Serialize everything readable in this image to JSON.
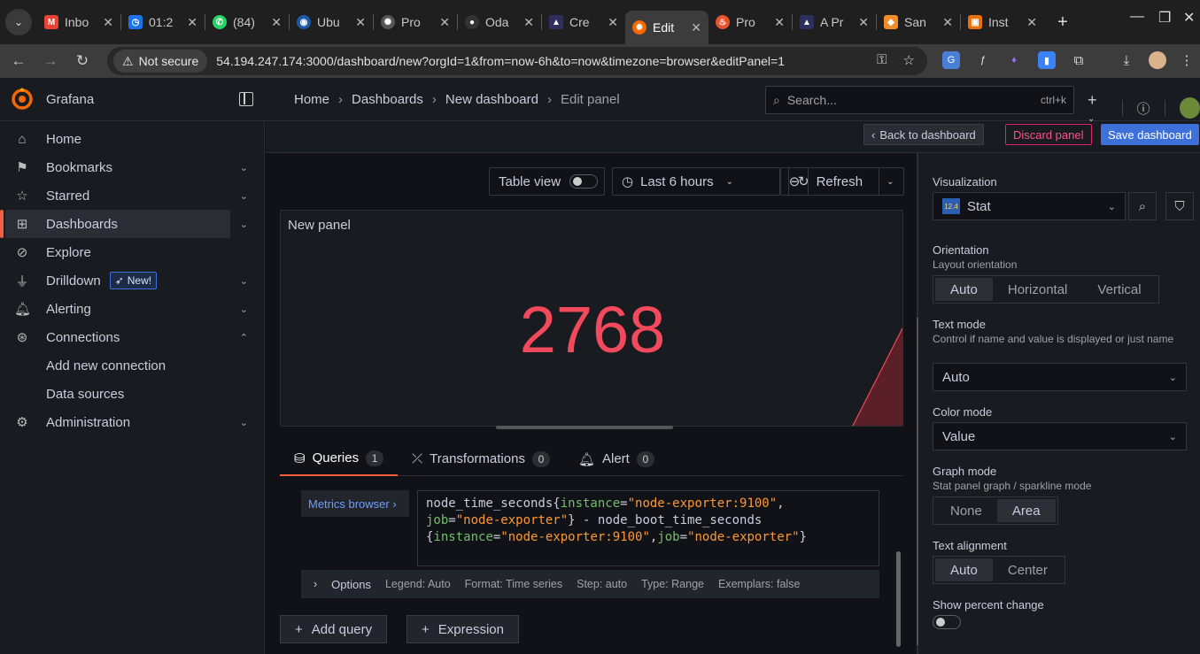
{
  "browser": {
    "tabs": [
      {
        "label": "Inbo",
        "icon": "gmail-icon",
        "color": "#ea4335"
      },
      {
        "label": "01:2",
        "icon": "clock-app-icon",
        "color": "#1a73e8"
      },
      {
        "label": "(84)",
        "icon": "whatsapp-icon",
        "color": "#25d366"
      },
      {
        "label": "Ubu",
        "icon": "ubuntu-icon",
        "color": "#1e5aa8"
      },
      {
        "label": "Pro",
        "icon": "chatgpt-icon",
        "color": "#444444"
      },
      {
        "label": "Oda",
        "icon": "github-icon",
        "color": "#333333"
      },
      {
        "label": "Cre",
        "icon": "atlassian-icon",
        "color": "#2f2f5f"
      },
      {
        "label": "Edit",
        "icon": "grafana-icon",
        "color": "#f46800"
      },
      {
        "label": "Pro",
        "icon": "prometheus-icon",
        "color": "#e6522c"
      },
      {
        "label": "A Pr",
        "icon": "atlassian-icon",
        "color": "#2f2f5f"
      },
      {
        "label": "San",
        "icon": "aws-icon",
        "color": "#f28c28"
      },
      {
        "label": "Inst",
        "icon": "instance-icon",
        "color": "#e8710a"
      }
    ],
    "active_tab": 7,
    "security_label": "Not secure",
    "url": "54.194.247.174:3000/dashboard/new?orgId=1&from=now-6h&to=now&timezone=browser&editPanel=1"
  },
  "grafana": {
    "brand": "Grafana",
    "breadcrumbs": [
      "Home",
      "Dashboards",
      "New dashboard",
      "Edit panel"
    ],
    "search_placeholder": "Search...",
    "search_shortcut": "ctrl+k",
    "add_label": "+"
  },
  "sidebar": {
    "items": [
      {
        "label": "Home",
        "icon": "home-icon"
      },
      {
        "label": "Bookmarks",
        "icon": "bookmark-icon"
      },
      {
        "label": "Starred",
        "icon": "star-icon"
      },
      {
        "label": "Dashboards",
        "icon": "dashboards-icon"
      },
      {
        "label": "Explore",
        "icon": "explore-icon"
      },
      {
        "label": "Drilldown",
        "icon": "drilldown-icon",
        "badge": "New!"
      },
      {
        "label": "Alerting",
        "icon": "bell-icon"
      },
      {
        "label": "Connections",
        "icon": "connections-icon"
      },
      {
        "label": "Add new connection"
      },
      {
        "label": "Data sources"
      },
      {
        "label": "Administration",
        "icon": "gear-icon"
      }
    ],
    "active": "Dashboards"
  },
  "toolbar": {
    "back_label": "Back to dashboard",
    "discard_label": "Discard panel",
    "save_label": "Save dashboard"
  },
  "panel_controls": {
    "table_view_label": "Table view",
    "time_range": "Last 6 hours",
    "refresh_label": "Refresh"
  },
  "panel": {
    "title": "New panel",
    "value": "2768",
    "value_color": "#f2495c"
  },
  "query_tabs": [
    {
      "label": "Queries",
      "count": "1"
    },
    {
      "label": "Transformations",
      "count": "0"
    },
    {
      "label": "Alert",
      "count": "0"
    }
  ],
  "query": {
    "metrics_browser_label": "Metrics browser ›",
    "line1_metric": "node_time_seconds{",
    "line1_k1": "instance",
    "line1_eq": "=",
    "line1_v1": "\"node-exporter:9100\"",
    "line1_end": ",",
    "line2_k": "job",
    "line2_eq": "=",
    "line2_v": "\"node-exporter\"",
    "line2_rest": "} - node_boot_time_seconds",
    "line3_open": "{",
    "line3_k1": "instance",
    "line3_eq1": "=",
    "line3_v1": "\"node-exporter:9100\"",
    "line3_comma": ",",
    "line3_k2": "job",
    "line3_eq2": "=",
    "line3_v2": "\"node-exporter\"",
    "line3_close": "}",
    "options_label": "Options",
    "options_summary": [
      "Legend: Auto",
      "Format: Time series",
      "Step: auto",
      "Type: Range",
      "Exemplars: false"
    ],
    "add_query_label": "Add query",
    "expression_label": "Expression"
  },
  "options_pane": {
    "visualization_label": "Visualization",
    "visualization_value": "Stat",
    "viz_icon_text": "12.4",
    "orientation_label": "Orientation",
    "orientation_desc": "Layout orientation",
    "orientation_options": [
      "Auto",
      "Horizontal",
      "Vertical"
    ],
    "orientation_selected": "Auto",
    "text_mode_label": "Text mode",
    "text_mode_desc": "Control if name and value is displayed or just name",
    "text_mode_value": "Auto",
    "color_mode_label": "Color mode",
    "color_mode_value": "Value",
    "graph_mode_label": "Graph mode",
    "graph_mode_desc": "Stat panel graph / sparkline mode",
    "graph_mode_options": [
      "None",
      "Area"
    ],
    "graph_mode_selected": "Area",
    "text_align_label": "Text alignment",
    "text_align_options": [
      "Auto",
      "Center"
    ],
    "text_align_selected": "Auto",
    "percent_change_label": "Show percent change",
    "percent_change_on": false
  }
}
